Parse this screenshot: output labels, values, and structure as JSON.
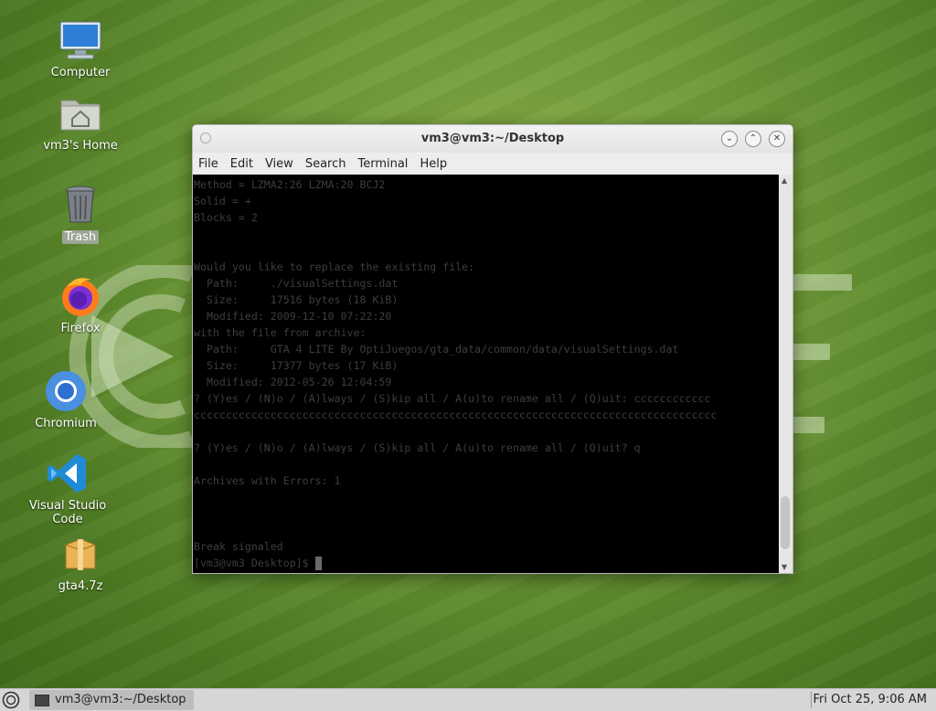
{
  "desktop": {
    "icons": [
      {
        "label": "Computer",
        "icon": "computer-icon"
      },
      {
        "label": "vm3's Home",
        "icon": "home-folder-icon"
      },
      {
        "label": "Trash",
        "icon": "trash-icon"
      },
      {
        "label": "Firefox",
        "icon": "firefox-icon"
      },
      {
        "label": "Chromium",
        "icon": "chromium-icon"
      },
      {
        "label": "Visual Studio Code",
        "icon": "vscode-icon"
      },
      {
        "label": "gta4.7z",
        "icon": "archive-icon"
      }
    ]
  },
  "window": {
    "title": "vm3@vm3:~/Desktop",
    "menu": [
      "File",
      "Edit",
      "View",
      "Search",
      "Terminal",
      "Help"
    ],
    "terminal_lines": [
      "Method = LZMA2:26 LZMA:20 BCJ2",
      "Solid = +",
      "Blocks = 2",
      "",
      "",
      "Would you like to replace the existing file:",
      "  Path:     ./visualSettings.dat",
      "  Size:     17516 bytes (18 KiB)",
      "  Modified: 2009-12-10 07:22:20",
      "with the file from archive:",
      "  Path:     GTA 4 LITE By OptiJuegos/gta_data/common/data/visualSettings.dat",
      "  Size:     17377 bytes (17 KiB)",
      "  Modified: 2012-05-26 12:04:59",
      "? (Y)es / (N)o / (A)lways / (S)kip all / A(u)to rename all / (Q)uit: cccccccccccc",
      "cccccccccccccccccccccccccccccccccccccccccccccccccccccccccccccccccccccccccccccccccc",
      "",
      "? (Y)es / (N)o / (A)lways / (S)kip all / A(u)to rename all / (Q)uit? q",
      "",
      "Archives with Errors: 1",
      "",
      "",
      "",
      "Break signaled"
    ],
    "prompt": "[vm3@vm3 Desktop]$ "
  },
  "taskbar": {
    "task_label": "vm3@vm3:~/Desktop",
    "clock": "Fri Oct 25,  9:06 AM"
  }
}
